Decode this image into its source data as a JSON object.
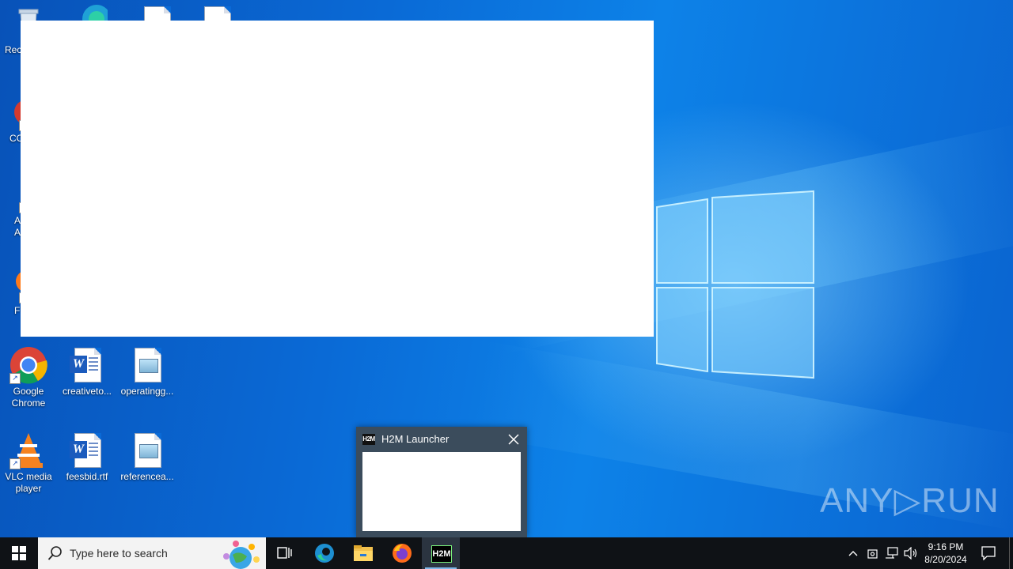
{
  "desktop": {
    "icons": [
      {
        "id": "recycle",
        "label": "Rec"
      },
      {
        "id": "ccleaner",
        "label": "CC"
      },
      {
        "id": "acrobat",
        "label": "A\nAc"
      },
      {
        "id": "firefox",
        "label": "F"
      },
      {
        "id": "chrome",
        "label": "Google Chrome"
      },
      {
        "id": "creativeto",
        "label": "creativeto..."
      },
      {
        "id": "operatingg",
        "label": "operatingg..."
      },
      {
        "id": "vlc",
        "label": "VLC media player"
      },
      {
        "id": "feesbid",
        "label": "feesbid.rtf"
      },
      {
        "id": "referencea",
        "label": "referencea..."
      }
    ]
  },
  "launcher": {
    "title": "H2M Launcher",
    "logo": "H2M"
  },
  "watermark": "ANY▷RUN",
  "taskbar": {
    "search_placeholder": "Type here to search",
    "clock_time": "9:16 PM",
    "clock_date": "8/20/2024",
    "active_app_logo": "H2M"
  },
  "colors": {
    "desktop_blue": "#0a6ad6",
    "taskbar": "#0f1216",
    "launcher_frame": "#3b4c5c"
  }
}
